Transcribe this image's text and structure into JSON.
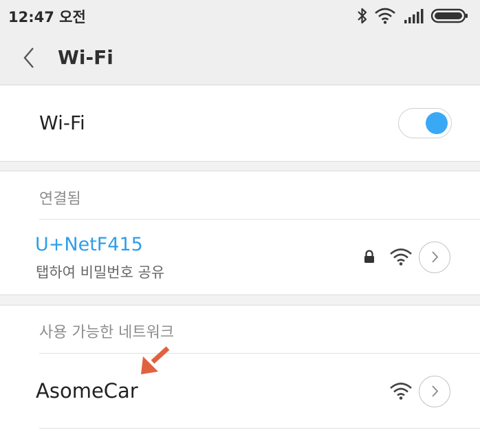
{
  "status_bar": {
    "time": "12:47 오전",
    "icons": [
      "bluetooth-icon",
      "wifi-icon",
      "cell-signal-icon",
      "battery-icon"
    ]
  },
  "title_bar": {
    "title": "Wi-Fi",
    "back_icon": "chevron-left-icon"
  },
  "wifi_toggle": {
    "label": "Wi-Fi",
    "enabled": true,
    "accent_color": "#3aa9f5"
  },
  "connected_section": {
    "header": "연결됨",
    "network": {
      "name": "U+NetF415",
      "subtitle": "탭하여 비밀번호 공유",
      "secured": true,
      "name_color": "#2f9ee9"
    }
  },
  "available_section": {
    "header": "사용 가능한 네트워크",
    "networks": [
      {
        "name": "AsomeCar",
        "secured": false
      }
    ]
  },
  "annotation": {
    "arrow_color": "#e0623f",
    "icon": "arrow-down-left-icon"
  }
}
